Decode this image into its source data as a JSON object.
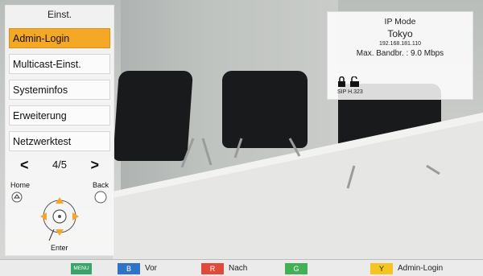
{
  "menu": {
    "title": "Einst.",
    "items": [
      {
        "label": "Admin-Login",
        "active": true
      },
      {
        "label": "Multicast-Einst.",
        "active": false
      },
      {
        "label": "Systeminfos",
        "active": false
      },
      {
        "label": "Erweiterung",
        "active": false
      },
      {
        "label": "Netzwerktest",
        "active": false
      }
    ],
    "pager": {
      "prev": "<",
      "count": "4/5",
      "next": ">"
    }
  },
  "nav": {
    "home_label": "Home",
    "back_label": "Back",
    "enter_label": "Enter"
  },
  "info": {
    "mode": "IP Mode",
    "site": "Tokyo",
    "ip": "192.168.181.110",
    "bandwidth": "Max. Bandbr. : 9.0 Mbps",
    "protocols": "SIP H.323"
  },
  "bottombar": {
    "menu_key": "MENU",
    "b_key": "B",
    "b_label": "Vor",
    "r_key": "R",
    "r_label": "Nach",
    "g_key": "G",
    "g_label": "",
    "y_key": "Y",
    "y_label": "Admin-Login"
  },
  "colors": {
    "accent": "#f5a726",
    "key_menu": "#3aa56a",
    "key_blue": "#2f73c8",
    "key_red": "#e04a3a",
    "key_green": "#44b054",
    "key_yellow": "#f5c420"
  }
}
